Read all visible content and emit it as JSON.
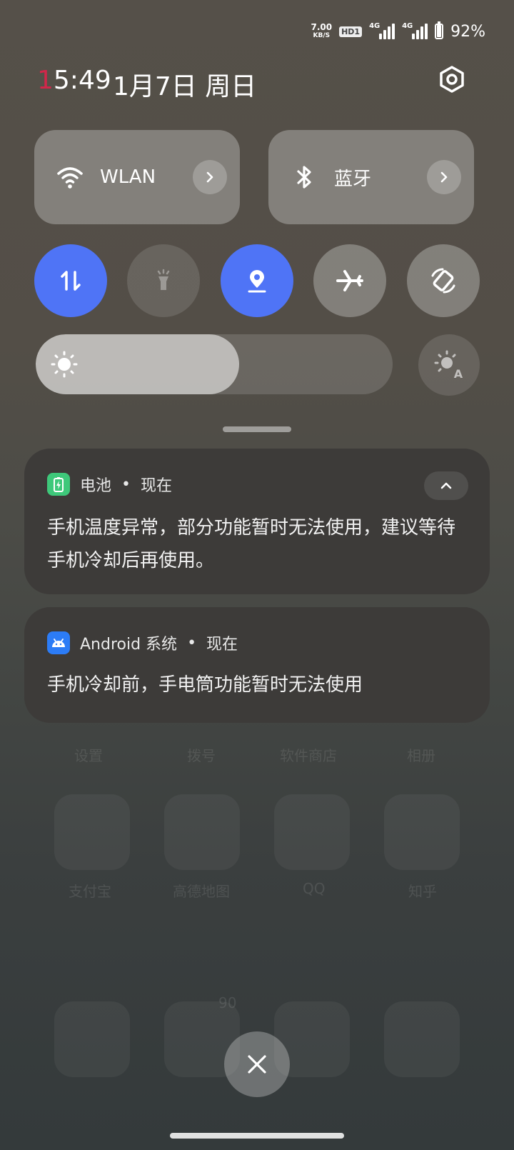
{
  "status_bar": {
    "speed_value": "7.00",
    "speed_unit": "KB/S",
    "hd_badge": "HD1",
    "sim1_type": "4G",
    "sim2_type": "4G",
    "battery_percent": "92%",
    "battery_level": 0.92
  },
  "header": {
    "time_first": "1",
    "time_rest": "5:49",
    "date": "1月7日 周日",
    "settings_icon": "gear-icon"
  },
  "tiles": {
    "wlan": {
      "label": "WLAN",
      "icon": "wifi-icon"
    },
    "bluetooth": {
      "label": "蓝牙",
      "icon": "bluetooth-icon"
    }
  },
  "quick_toggles": [
    {
      "name": "mobile-data",
      "icon": "data-arrows-icon",
      "state": "on"
    },
    {
      "name": "flashlight",
      "icon": "flashlight-icon",
      "state": "disabled"
    },
    {
      "name": "location",
      "icon": "location-icon",
      "state": "on"
    },
    {
      "name": "airplane-mode",
      "icon": "airplane-icon",
      "state": "off"
    },
    {
      "name": "auto-rotate",
      "icon": "rotate-icon",
      "state": "off"
    }
  ],
  "brightness": {
    "level": 0.57,
    "auto_label": "A"
  },
  "notifications": [
    {
      "app": "电池",
      "sep": "•",
      "time": "现在",
      "body": "手机温度异常，部分功能暂时无法使用，建议等待手机冷却后再使用。",
      "icon": "battery-app-icon",
      "color": "#3ec87a"
    },
    {
      "app": "Android 系统",
      "sep": "•",
      "time": "现在",
      "body": "手机冷却前，手电筒功能暂时无法使用",
      "icon": "android-icon",
      "color": "#2c7cf6"
    }
  ],
  "background_apps": {
    "row1": [
      "设置",
      "拨号",
      "软件商店",
      "相册"
    ],
    "row2": [
      "支付宝",
      "高德地图",
      "QQ",
      "知乎"
    ],
    "badge": "90"
  },
  "colors": {
    "accent": "#4f74f6",
    "clock_red": "#d0274a"
  }
}
